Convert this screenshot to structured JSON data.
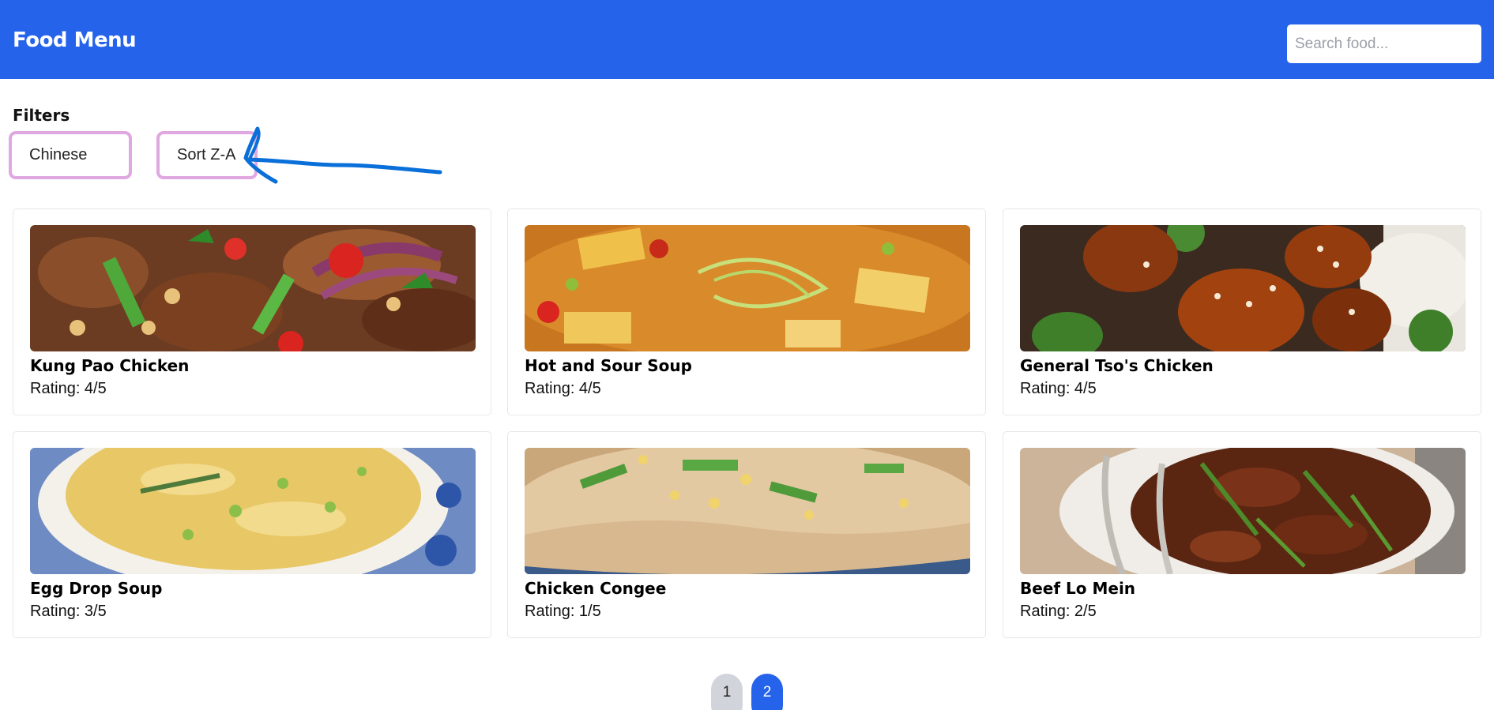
{
  "header": {
    "title": "Food Menu",
    "search_placeholder": "Search food...",
    "background_color": "#2563eb"
  },
  "filters": {
    "title": "Filters",
    "chips": [
      "Chinese",
      "Sort Z-A"
    ]
  },
  "annotation": {
    "type": "hand-drawn arrow pointing at Sort Z-A chip",
    "color": "#0a6fd8"
  },
  "cards": [
    {
      "name": "Kung Pao Chicken",
      "rating": "Rating: 4/5"
    },
    {
      "name": "Hot and Sour Soup",
      "rating": "Rating: 4/5"
    },
    {
      "name": "General Tso's Chicken",
      "rating": "Rating: 4/5"
    },
    {
      "name": "Egg Drop Soup",
      "rating": "Rating: 3/5"
    },
    {
      "name": "Chicken Congee",
      "rating": "Rating: 1/5"
    },
    {
      "name": "Beef Lo Mein",
      "rating": "Rating: 2/5"
    }
  ],
  "pagination": {
    "pages": [
      "1",
      "2"
    ],
    "current": "2",
    "active_color": "#2563eb"
  }
}
